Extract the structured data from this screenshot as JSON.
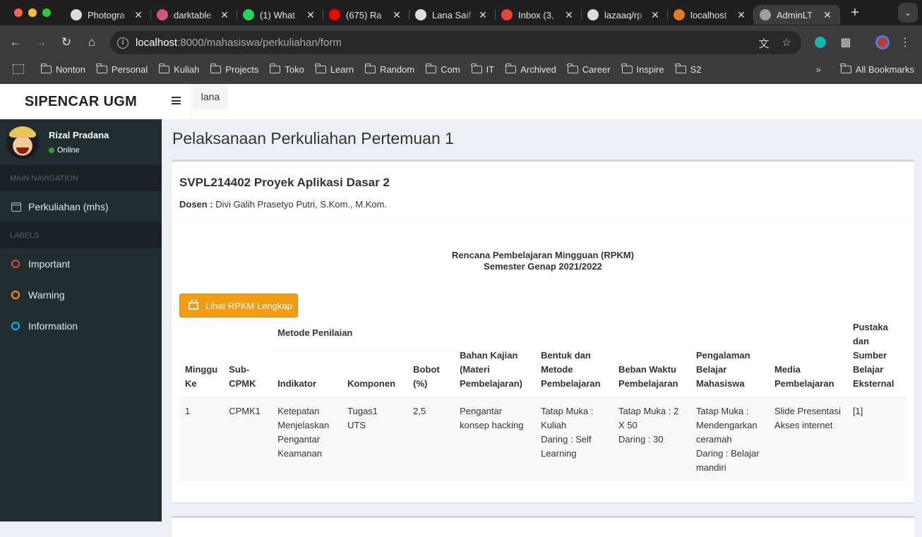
{
  "browser": {
    "tabs": [
      {
        "title": "Photogra",
        "fav_color": "#dcdcdc"
      },
      {
        "title": "darktable",
        "fav_color": "#d94f8a"
      },
      {
        "title": "(1) What",
        "fav_color": "#25d366"
      },
      {
        "title": "(675) Ra",
        "fav_color": "#ff0000"
      },
      {
        "title": "Lana Saif",
        "fav_color": "#dcdcdc"
      },
      {
        "title": "Inbox (3,",
        "fav_color": "#ea4335"
      },
      {
        "title": "lazaaq/rp",
        "fav_color": "#dcdcdc"
      },
      {
        "title": "localhost",
        "fav_color": "#e07b2a"
      },
      {
        "title": "AdminLT",
        "fav_color": "#9aa0a6"
      }
    ],
    "url_host": "localhost",
    "url_path": ":8000/mahasiswa/perkuliahan/form",
    "bookmarks": [
      "Nonton",
      "Personal",
      "Kuliah",
      "Projects",
      "Toko",
      "Learn",
      "Random",
      "Com",
      "IT",
      "Archived",
      "Career",
      "Inspire",
      "S2"
    ],
    "all_bookmarks": "All Bookmarks"
  },
  "sidebar": {
    "brand": "SIPENCAR UGM",
    "user_name": "Rizal Pradana",
    "user_status": "Online",
    "main_nav_header": "MAIN NAVIGATION",
    "nav_items": [
      {
        "label": "Perkuliahan (mhs)",
        "icon": "calendar-icon"
      }
    ],
    "labels_header": "LABELS",
    "labels": [
      {
        "label": "Important",
        "color": "#dd4b39"
      },
      {
        "label": "Warning",
        "color": "#f39c12"
      },
      {
        "label": "Information",
        "color": "#00c0ef"
      }
    ]
  },
  "header": {
    "user": "lana"
  },
  "content": {
    "page_title": "Pelaksanaan Perkuliahan Pertemuan 1",
    "course": "SVPL214402 Proyek Aplikasi Dasar 2",
    "dosen_label": "Dosen :",
    "dosen_name": "Divi Galih Prasetyo Putri, S.Kom., M.Kom.",
    "rpkm_title": "Rencana Pembelajaran Mingguan (RPKM)",
    "rpkm_semester": "Semester Genap 2021/2022",
    "button_label": "Lihat RPKM Lengkap",
    "table": {
      "headers": {
        "minggu": "Minggu Ke",
        "subcpmk": "Sub-CPMK",
        "metode_penilaian": "Metode Penilaian",
        "indikator": "Indikator",
        "komponen": "Komponen",
        "bobot": "Bobot (%)",
        "bahan": "Bahan Kajian (Materi Pembelajaran)",
        "bentuk": "Bentuk dan Metode Pembelajaran",
        "beban": "Beban Waktu Pembelajaran",
        "pengalaman": "Pengalaman Belajar Mahasiswa",
        "media": "Media Pembelajaran",
        "pustaka": "Pustaka dan Sumber Belajar Eksternal"
      },
      "row": {
        "minggu": "1",
        "subcpmk": "CPMK1",
        "indikator": "Ketepatan Menjelaskan Pengantar Keamanan",
        "komponen_1": "Tugas1",
        "komponen_2": "UTS",
        "bobot": "2,5",
        "bahan": "Pengantar konsep hacking",
        "bentuk_1": "Tatap Muka : Kuliah",
        "bentuk_2": "Daring : Self Learning",
        "beban_1": "Tatap Muka : 2 X 50",
        "beban_2": "Daring : 30",
        "pengalaman_1": "Tatap Muka : Mendengarkan ceramah",
        "pengalaman_2": "Daring : Belajar mandiri",
        "media_1": "Slide Presentasi",
        "media_2": "Akses internet",
        "pustaka": "[1]"
      }
    }
  }
}
